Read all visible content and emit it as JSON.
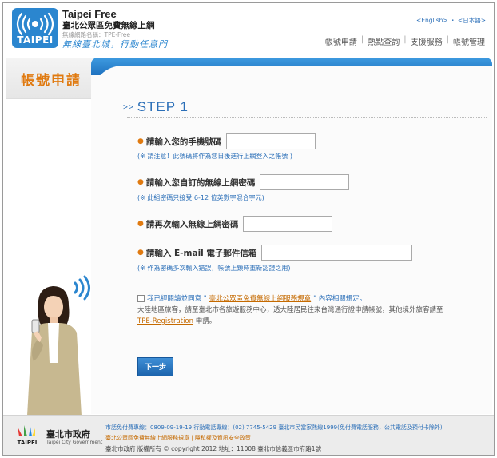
{
  "header": {
    "logo_text": "TAIPEI",
    "brand_title": "Taipei Free",
    "brand_subtitle": "臺北公眾區免費無線上網",
    "ssid_label": "無線網路名稱：TPE-Free",
    "slogan": "無線臺北城，行動任意門",
    "lang_english": "<English>",
    "lang_sep": " ・ ",
    "lang_japanese": "<日本語>",
    "nav": [
      "帳號申請",
      "熱點查詢",
      "支援服務",
      "帳號管理"
    ]
  },
  "banner": {
    "title": "帳號申請"
  },
  "form": {
    "step_title": "STEP 1",
    "step_chevron": ">>",
    "phone_label": "請輸入您的手機號碼",
    "phone_note": "(※ 請注意！此號碼將作為您日後進行上網登入之帳號 )",
    "password_label": "請輸入您自訂的無線上網密碼",
    "password_note": "(※ 此組密碼只接受 6-12 位英數字混合字元)",
    "confirm_label": "請再次輸入無線上網密碼",
    "email_label": "請輸入 E-mail 電子郵件信箱",
    "email_note": "(※ 作為密碼多次輸入錯誤，帳號上鎖時重新認證之用)",
    "agree_prefix": "我已經閱讀並同意 \"",
    "agree_link": "臺北公眾區免費無線上網服務規章",
    "agree_suffix": "\" 內容相關規定。",
    "info_line1": "大陸地區旅客，請至臺北市各旅遊服務中心，透大陸居民往來台灣通行證申請帳號，其他境外旅客請至",
    "info_link": "TPE-Registration",
    "info_suffix": " 申請。",
    "next_button": "下一步"
  },
  "footer": {
    "logo_text": "TAIPEI",
    "org_name": "臺北市政府",
    "org_name_en": "Taipei City Government",
    "line1": "市話免付費專線：0809-09-19-19 行動電話專線：(02) 7745-5429 臺北市民當家熱線1999(免付費電話服務，公共電話及預付卡除外)",
    "line2": "臺北公眾區免費無線上網服務規章 | 隱私權及資訊安全政策",
    "line3": "臺北市政府 版權所有 © copyright 2012 地址：11008 臺北市信義區市府路1號"
  }
}
